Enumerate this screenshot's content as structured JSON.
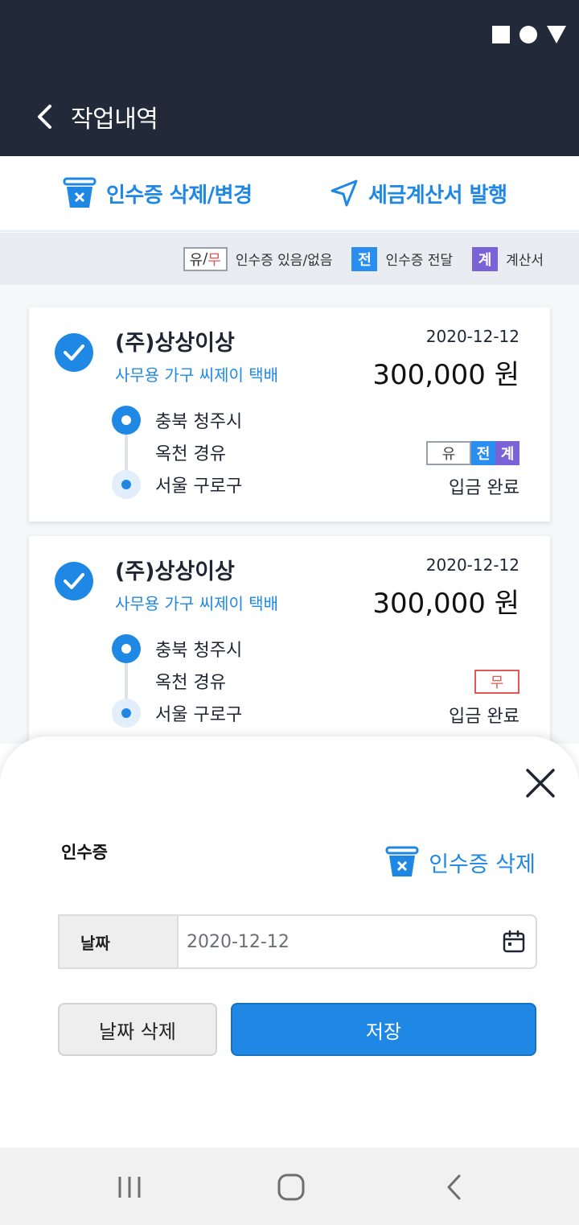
{
  "statusbar": {
    "icons": [
      "square-icon",
      "circle-icon",
      "triangle-icon"
    ]
  },
  "appbar": {
    "title": "작업내역",
    "back_icon": "chevron-left-icon"
  },
  "actions": {
    "receipt_edit_label": "인수증 삭제/변경",
    "tax_invoice_label": "세금계산서 발행"
  },
  "legend": {
    "yu": "유",
    "slash": "/",
    "mu": "무",
    "has_receipt_label": "인수증 있음/없음",
    "transfer_badge": "전",
    "transfer_label": "인수증 전달",
    "invoice_badge": "계",
    "invoice_label": "계산서"
  },
  "orders": [
    {
      "company": "(주)상상이상",
      "item": "사무용 가구 씨제이 택배",
      "date": "2020-12-12",
      "amount": "300,000 원",
      "origin": "충북 청주시",
      "via": "옥천 경유",
      "destination": "서울 구로구",
      "badges": {
        "receipt": "유",
        "transfer": "전",
        "invoice": "계"
      },
      "status": "입금 완료"
    },
    {
      "company": "(주)상상이상",
      "item": "사무용 가구 씨제이 택배",
      "date": "2020-12-12",
      "amount": "300,000 원",
      "origin": "충북 청주시",
      "via": "옥천 경유",
      "destination": "서울 구로구",
      "badges": {
        "receipt": "무"
      },
      "status": "입금 완료"
    }
  ],
  "sheet": {
    "title": "인수증",
    "delete_label": "인수증 삭제",
    "date_label": "날짜",
    "date_value": "2020-12-12",
    "clear_button": "날짜 삭제",
    "save_button": "저장"
  },
  "colors": {
    "primary": "#1f88e5",
    "header": "#222a3a",
    "purple": "#7a63d6",
    "red": "#e15858"
  }
}
